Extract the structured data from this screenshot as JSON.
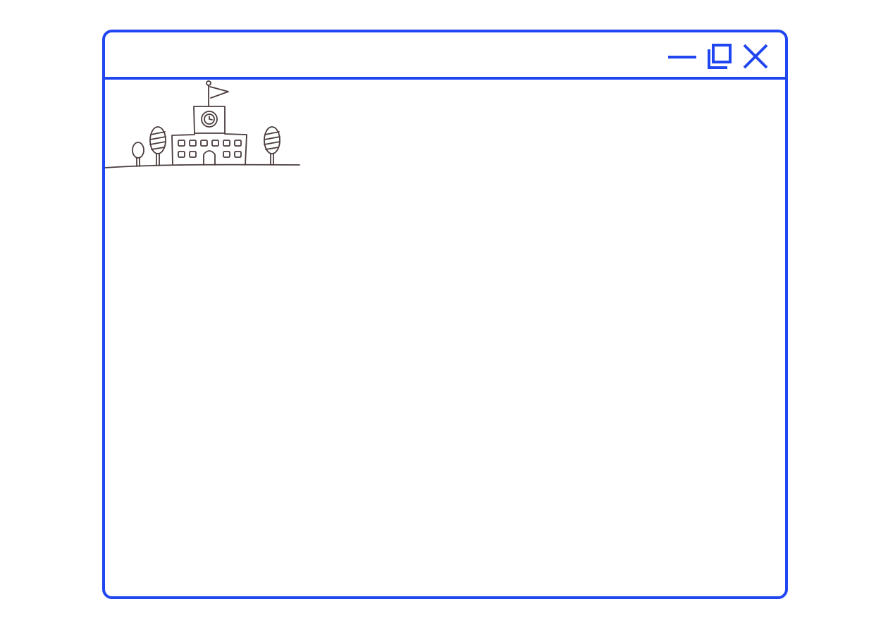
{
  "window": {
    "title": "",
    "accent_color": "#1f46f0",
    "controls": {
      "minimize_icon": "minimize-icon",
      "restore_icon": "restore-icon",
      "close_icon": "close-icon"
    }
  },
  "content": {
    "illustration_icon": "school-building-illustration",
    "line_color": "#4a3c3c"
  }
}
